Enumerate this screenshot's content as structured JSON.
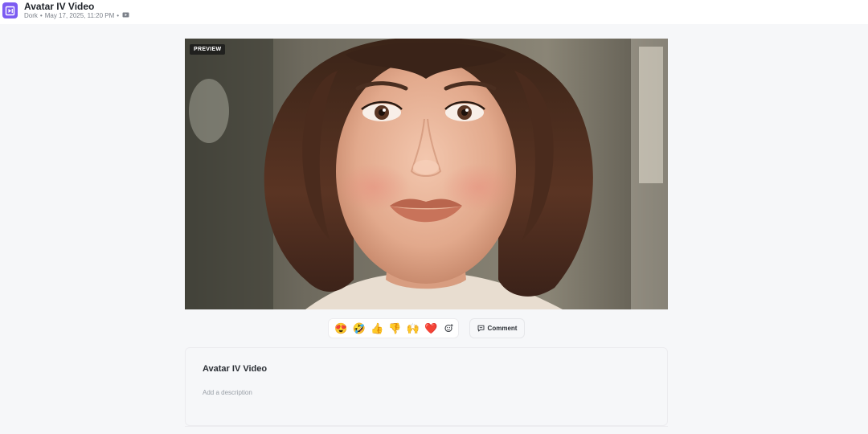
{
  "header": {
    "title": "Avatar IV Video",
    "author": "Dork",
    "date": "May 17, 2025, 11:20 PM",
    "separator": "•",
    "logo_icon": "play-logo-icon",
    "video_icon": "video-icon"
  },
  "player": {
    "badge": "PREVIEW"
  },
  "reactions": {
    "items": [
      {
        "emoji": "😍",
        "icon": "heart-eyes-emoji-icon"
      },
      {
        "emoji": "🤣",
        "icon": "rofl-emoji-icon"
      },
      {
        "emoji": "👍",
        "icon": "thumbs-up-emoji-icon"
      },
      {
        "emoji": "👎",
        "icon": "thumbs-down-emoji-icon"
      },
      {
        "emoji": "🙌",
        "icon": "raised-hands-emoji-icon"
      },
      {
        "emoji": "❤️",
        "icon": "heart-emoji-icon"
      }
    ],
    "add_icon": "add-reaction-icon"
  },
  "comment": {
    "label": "Comment",
    "icon": "comment-icon"
  },
  "details": {
    "title": "Avatar IV Video",
    "description_placeholder": "Add a description"
  },
  "colors": {
    "accent": "#7c5cf2",
    "background": "#f6f7f9"
  }
}
